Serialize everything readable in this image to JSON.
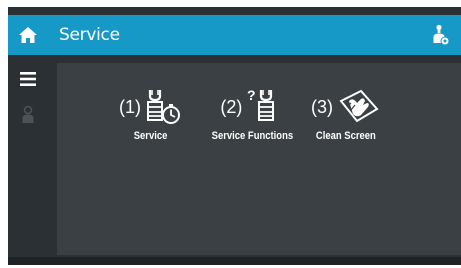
{
  "header": {
    "title": "Service"
  },
  "sidebar": {
    "icons": [
      "home-icon",
      "menu-icon",
      "user-icon"
    ]
  },
  "tiles": [
    {
      "number": "(1)",
      "label": "Service",
      "icon": "wrench-stopwatch-icon"
    },
    {
      "number": "(2)",
      "label": "Service Functions",
      "icon": "wrench-question-icon"
    },
    {
      "number": "(3)",
      "label": "Clean Screen",
      "icon": "hand-wiping-screen-icon"
    }
  ],
  "colors": {
    "accent": "#1799c8",
    "background": "#2b3034",
    "panel": "#3a4043"
  }
}
